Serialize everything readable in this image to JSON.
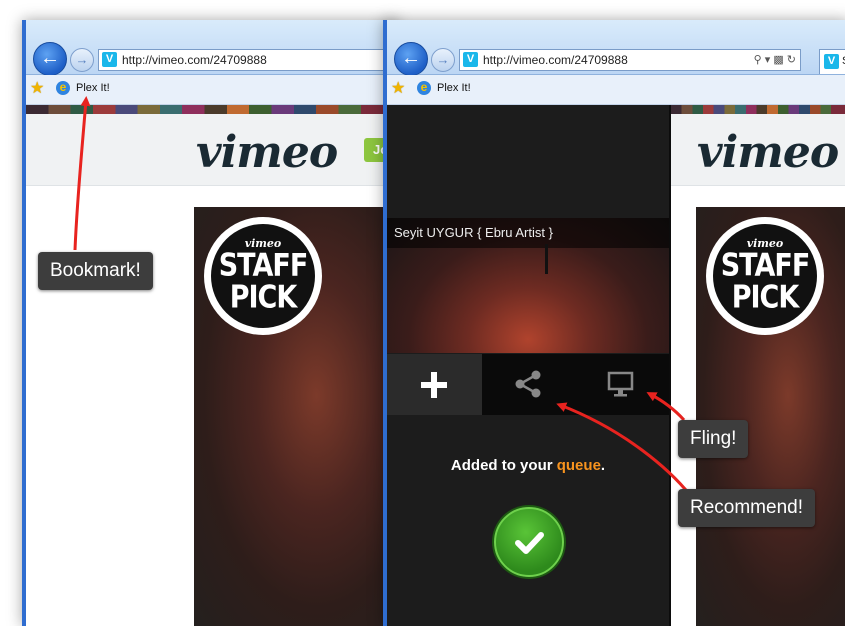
{
  "left_window": {
    "url": "http://vimeo.com/24709888",
    "favorites": {
      "bookmark_label": "Plex It!"
    },
    "vimeo": {
      "logo": "vimeo",
      "join_button": "Jo"
    },
    "staff_pick": {
      "brand": "vimeo",
      "line1": "STAFF",
      "line2": "PICK"
    }
  },
  "right_window": {
    "url": "http://vimeo.com/24709888",
    "tab_label": "S",
    "favorites": {
      "bookmark_label": "Plex It!"
    },
    "plex_panel": {
      "video_title": "Seyit UYGUR { Ebru Artist }",
      "actions": [
        {
          "icon": "plus-icon",
          "label": "Add to queue"
        },
        {
          "icon": "share-icon",
          "label": "Recommend"
        },
        {
          "icon": "monitor-icon",
          "label": "Fling"
        }
      ],
      "confirmation_prefix": "Added to your ",
      "confirmation_link": "queue",
      "confirmation_suffix": "."
    },
    "vimeo": {
      "logo": "vimeo"
    },
    "staff_pick": {
      "brand": "vimeo",
      "line1": "STAFF",
      "line2": "PICK"
    }
  },
  "annotations": {
    "bookmark": "Bookmark!",
    "fling": "Fling!",
    "recommend": "Recommend!"
  },
  "colors": {
    "annotation_arrow": "#e8231f",
    "vimeo_blue": "#1ab7ea",
    "queue_orange": "#f7931e",
    "success_green": "#3da32a"
  }
}
